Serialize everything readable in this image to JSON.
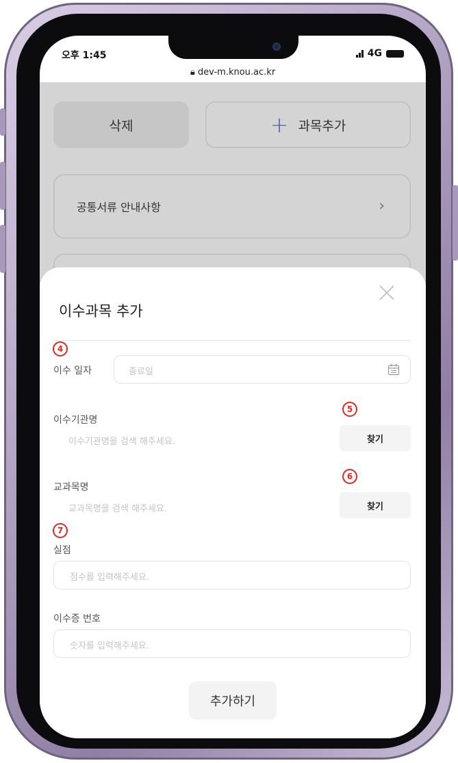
{
  "status_bar": {
    "time": "오후 1:45",
    "network": "4G",
    "url": "dev-m.knou.ac.kr"
  },
  "page": {
    "delete_label": "삭제",
    "add_course_label": "과목추가",
    "notice_label": "공통서류 안내사항",
    "chevron": "›"
  },
  "sheet": {
    "title": "이수과목 추가",
    "close_glyph": "✕",
    "markers": {
      "m4": "4",
      "m5": "5",
      "m6": "6",
      "m7": "7"
    },
    "completion_date": {
      "label": "이수 일자",
      "placeholder": "종료일"
    },
    "institution": {
      "label": "이수기관명",
      "placeholder": "이수기관명을 검색 해주세요.",
      "button": "찾기"
    },
    "course": {
      "label": "교과목명",
      "placeholder": "교과목명을 검색 해주세요.",
      "button": "찾기"
    },
    "credits": {
      "label": "실점",
      "placeholder": "점수를 입력해주세요."
    },
    "certificate_no": {
      "label": "이수증 번호",
      "placeholder": "숫자를 입력해주세요."
    },
    "submit_label": "추가하기"
  },
  "colors": {
    "accent_plus": "#4a62a8",
    "marker_red": "#e0281f",
    "dim_bg": "#d4d4d4"
  }
}
